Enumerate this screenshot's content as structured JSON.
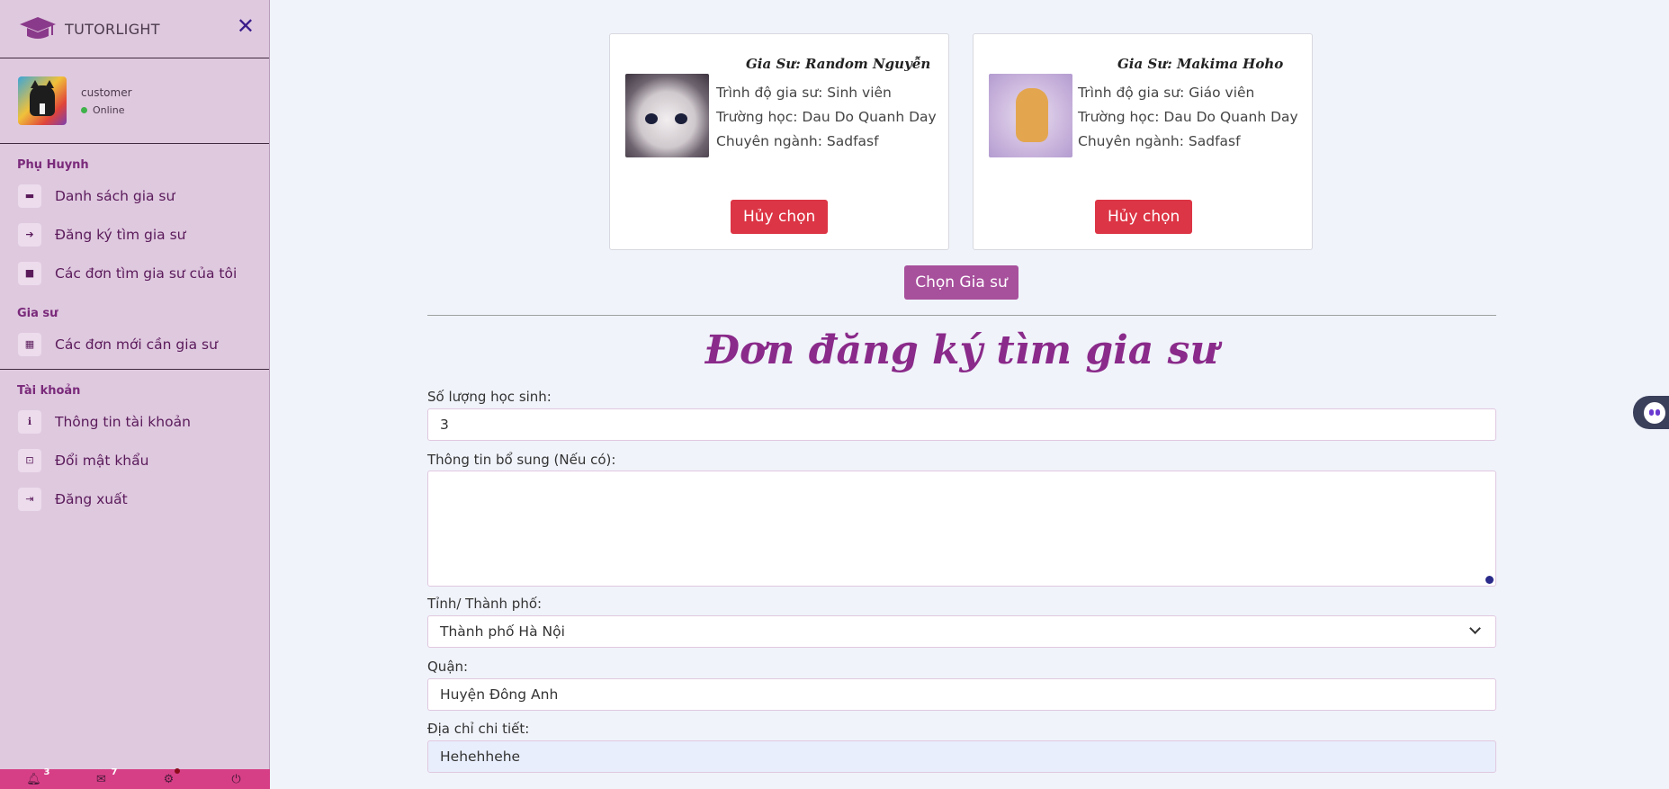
{
  "sidebar": {
    "brand": "TUTORLIGHT",
    "user": {
      "name": "customer",
      "status": "Online"
    },
    "sections": [
      {
        "title": "Phụ Huynh",
        "items": [
          {
            "label": "Danh sách gia sư",
            "icon": "id-card-icon"
          },
          {
            "label": "Đăng ký tìm gia sư",
            "icon": "sign-in-icon"
          },
          {
            "label": "Các đơn tìm gia sư của tôi",
            "icon": "book-icon"
          }
        ]
      },
      {
        "title": "Gia sư",
        "items": [
          {
            "label": "Các đơn mới cần gia sư",
            "icon": "calendar-icon"
          }
        ]
      },
      {
        "title": "Tài khoản",
        "items": [
          {
            "label": "Thông tin tài khoản",
            "icon": "info-icon"
          },
          {
            "label": "Đổi mật khẩu",
            "icon": "unlock-icon"
          },
          {
            "label": "Đăng xuất",
            "icon": "sign-out-icon"
          }
        ]
      }
    ],
    "bottom_bar": {
      "notifications": "3",
      "messages": "7"
    }
  },
  "tutors": [
    {
      "name": "Gia Sư: Random Nguyễn",
      "level": "Trình độ gia sư: Sinh viên",
      "school": "Trường học: Dau Do Quanh Day",
      "major": "Chuyên ngành: Sadfasf",
      "button": "Hủy chọn"
    },
    {
      "name": "Gia Sư: Makima Hoho",
      "level": "Trình độ gia sư: Giáo viên",
      "school": "Trường học: Dau Do Quanh Day",
      "major": "Chuyên ngành: Sadfasf",
      "button": "Hủy chọn"
    }
  ],
  "choose_button": "Chọn Gia sư",
  "form": {
    "title": "Đơn đăng ký tìm gia sư",
    "students_label": "Số lượng học sinh:",
    "students_value": "3",
    "extra_label": "Thông tin bổ sung (Nếu có):",
    "extra_value": "",
    "province_label": "Tỉnh/ Thành phố:",
    "province_value": "Thành phố Hà Nội",
    "district_label": "Quận:",
    "district_value": "Huyện Đông Anh",
    "address_label": "Địa chỉ chi tiết:",
    "address_value": "Hehehhehe"
  }
}
